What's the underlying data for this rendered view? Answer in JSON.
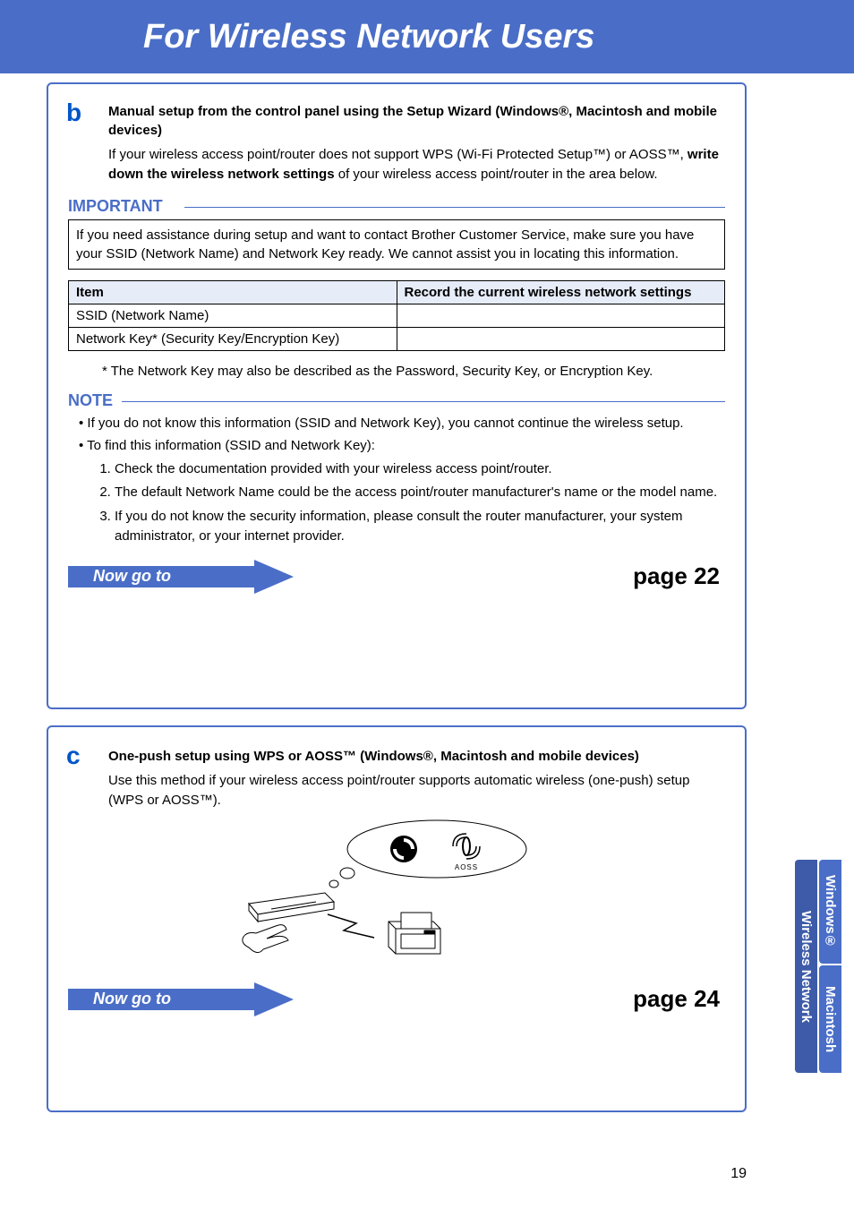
{
  "header": {
    "title": "For Wireless Network Users"
  },
  "section_b": {
    "letter": "b",
    "title": "Manual setup from the control panel using the Setup Wizard (Windows®, Macintosh and mobile devices)",
    "intro_prefix": "If your wireless access point/router does not support WPS (Wi-Fi Protected Setup™) or AOSS™, ",
    "intro_bold": "write down the wireless network settings",
    "intro_suffix": " of your wireless access point/router in the area below.",
    "important_label": "IMPORTANT",
    "important_text": "If you need assistance during setup and want to contact Brother Customer Service, make sure you have your SSID (Network Name) and Network Key ready. We cannot assist you in locating this information.",
    "table": {
      "head_item": "Item",
      "head_record": "Record the current wireless network settings",
      "row1": "SSID (Network Name)",
      "row2": "Network Key* (Security Key/Encryption Key)"
    },
    "footnote": "*  The Network Key may also be described as the Password, Security Key, or Encryption Key.",
    "note_label": "NOTE",
    "note_b1": "If you do not know this information (SSID and Network Key), you cannot continue the wireless setup.",
    "note_b2": "To find this information (SSID and Network Key):",
    "note_o1": "Check the documentation provided with your wireless access point/router.",
    "note_o2": "The default Network Name could be the access point/router manufacturer's name or the model name.",
    "note_o3": "If you do not know the security information, please consult the router manufacturer, your system administrator, or your internet provider.",
    "goto_label": "Now go to",
    "goto_page": "page 22"
  },
  "section_c": {
    "letter": "c",
    "title": "One-push setup using WPS or AOSS™ (Windows®, Macintosh and mobile devices)",
    "text": "Use this method if your wireless access point/router supports automatic wireless (one-push) setup (WPS or AOSS™).",
    "aoss_label": "AOSS",
    "goto_label": "Now go to",
    "goto_page": "page 24"
  },
  "side_tabs": {
    "wireless": "Wireless Network",
    "windows": "Windows®",
    "mac": "Macintosh"
  },
  "page_number": "19"
}
